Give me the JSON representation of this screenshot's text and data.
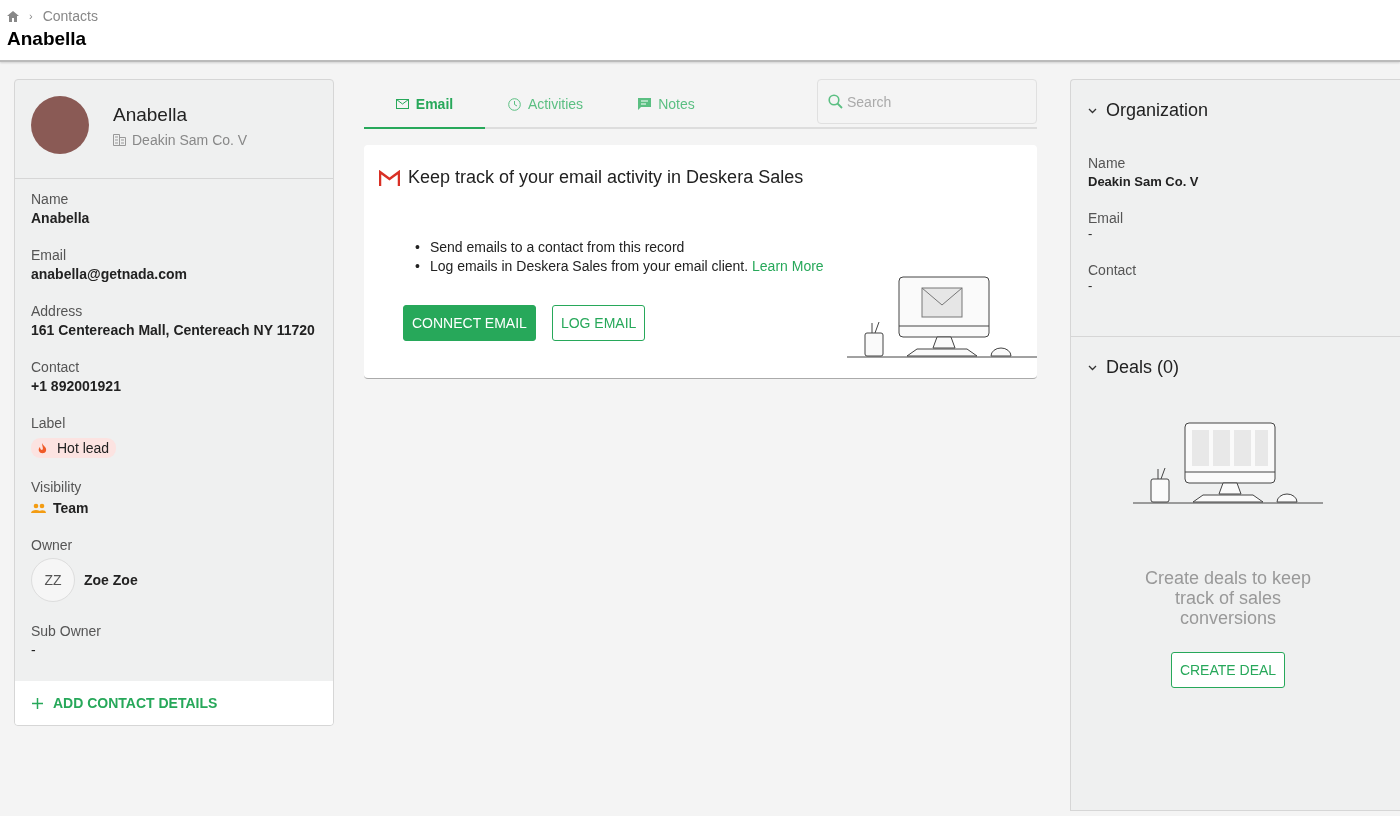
{
  "breadcrumb": {
    "separator": "›",
    "items": [
      "Contacts"
    ]
  },
  "page_title": "Anabella",
  "contact": {
    "name": "Anabella",
    "company": "Deakin Sam Co. V",
    "fields": [
      {
        "kind": "text",
        "label": "Name",
        "value": "Anabella"
      },
      {
        "kind": "text",
        "label": "Email",
        "value": "anabella@getnada.com"
      },
      {
        "kind": "text",
        "label": "Address",
        "value": "161 Centereach Mall, Centereach NY 11720"
      },
      {
        "kind": "text",
        "label": "Contact",
        "value": "+1 892001921"
      },
      {
        "kind": "tag",
        "label": "Label",
        "value": "Hot lead"
      },
      {
        "kind": "visibility",
        "label": "Visibility",
        "value": "Team"
      },
      {
        "kind": "owner",
        "label": "Owner",
        "initials": "ZZ",
        "value": "Zoe Zoe"
      },
      {
        "kind": "plain",
        "label": "Sub Owner",
        "value": "-"
      }
    ],
    "add_button": "ADD CONTACT DETAILS"
  },
  "tabs": [
    {
      "label": "Email",
      "selected": true
    },
    {
      "label": "Activities",
      "selected": false
    },
    {
      "label": "Notes",
      "selected": false
    }
  ],
  "search": {
    "placeholder": "Search"
  },
  "email_card": {
    "title": "Keep track of your email activity in Deskera Sales",
    "bullets": [
      {
        "marker": "•",
        "text": "Send emails to a contact from this record"
      },
      {
        "marker": "•",
        "text": "Log emails in Deskera Sales from your email client.",
        "link": "Learn More"
      }
    ],
    "buttons": [
      {
        "label": "CONNECT EMAIL",
        "kind": "primary"
      },
      {
        "label": "LOG EMAIL",
        "kind": "outline"
      }
    ]
  },
  "sections": [
    {
      "title": "Organization",
      "expanded": true,
      "fields": [
        {
          "label": "Name",
          "value": "Deakin Sam Co. V"
        },
        {
          "label": "Email",
          "value": "-"
        },
        {
          "label": "Contact",
          "value": "-"
        }
      ]
    },
    {
      "title": "Deals (0)",
      "expanded": true,
      "empty_text": "Create deals to keep track of sales conversions",
      "button": "CREATE DEAL"
    }
  ]
}
